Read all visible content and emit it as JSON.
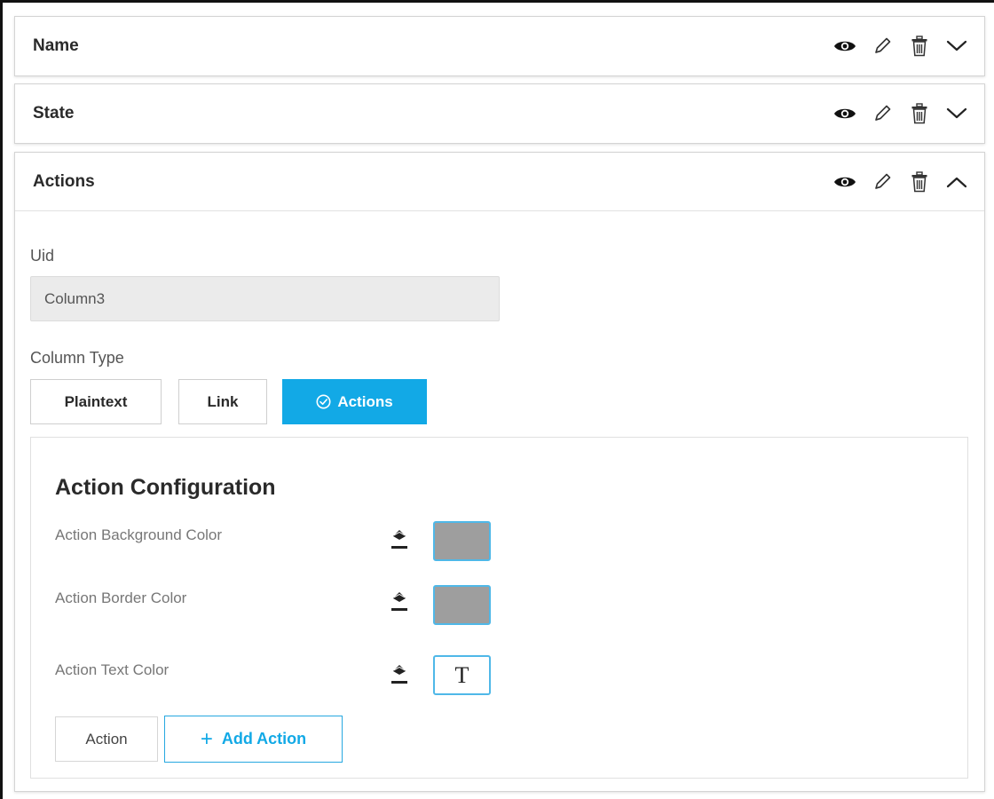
{
  "panels": [
    {
      "title": "Name",
      "expanded": false
    },
    {
      "title": "State",
      "expanded": false
    },
    {
      "title": "Actions",
      "expanded": true
    }
  ],
  "header_icons": [
    "eye-icon",
    "pencil-icon",
    "trash-icon",
    "chevron-icon"
  ],
  "form": {
    "uid_label": "Uid",
    "uid_value": "Column3",
    "column_type_label": "Column Type",
    "column_types": [
      "Plaintext",
      "Link",
      "Actions"
    ],
    "selected_column_type": "Actions"
  },
  "action_config": {
    "title": "Action Configuration",
    "background_color_label": "Action Background Color",
    "background_color": "#9e9e9e",
    "border_color_label": "Action Border Color",
    "border_color": "#9e9e9e",
    "text_color_label": "Action Text Color",
    "text_color_glyph": "T",
    "action_button_label": "Action",
    "add_action_label": "Add Action",
    "add_action_symbol": "+"
  },
  "colors": {
    "accent": "#12a9e6",
    "swatch_border": "#4fb8e8"
  }
}
